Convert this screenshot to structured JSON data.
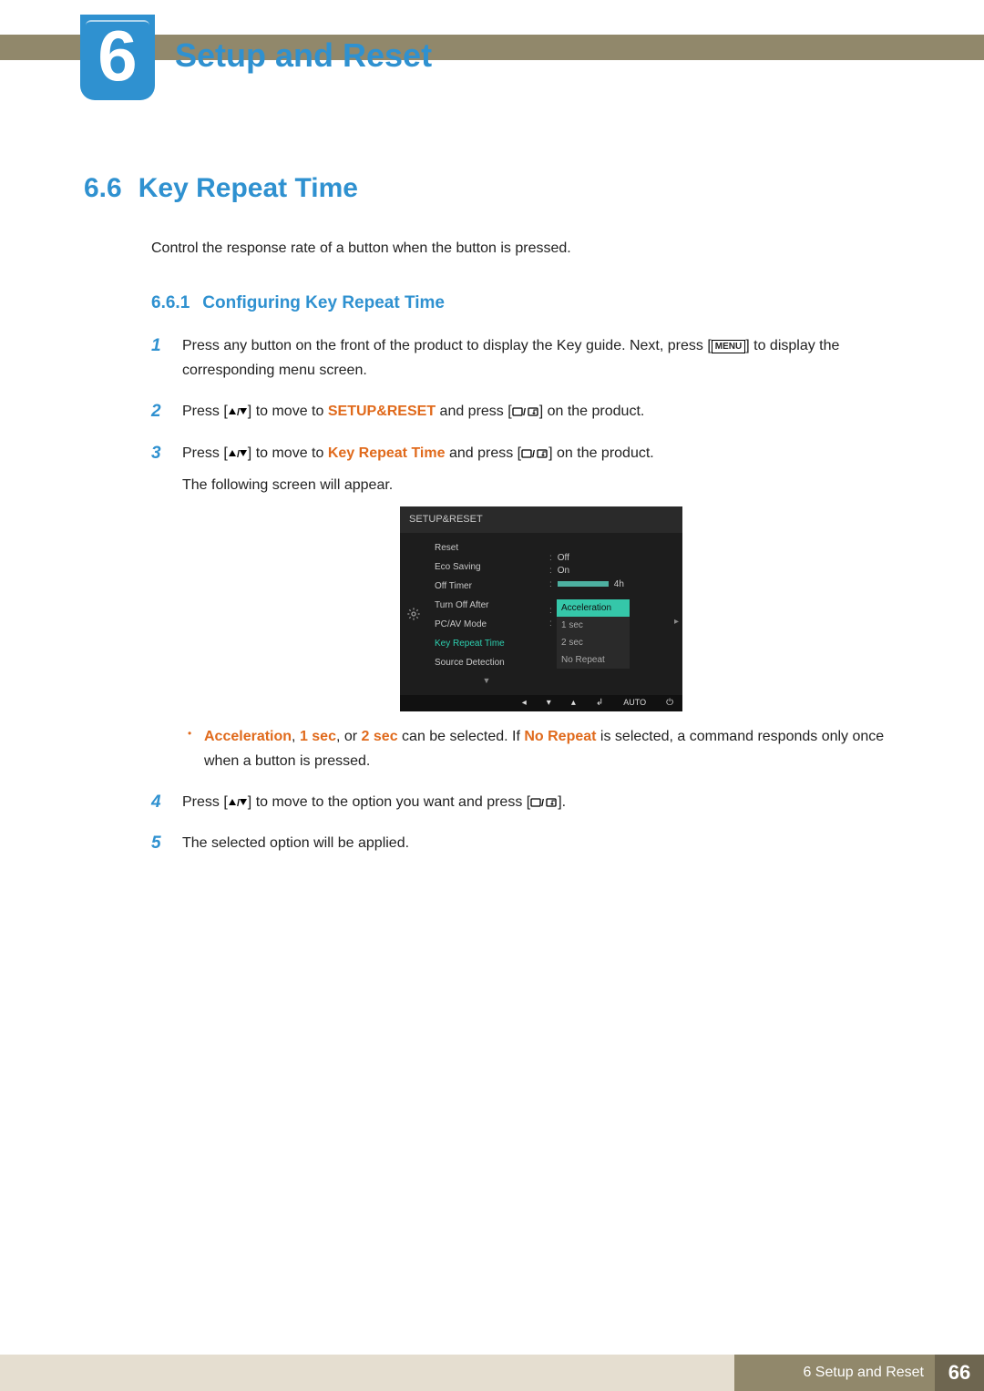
{
  "chapter": {
    "number": "6",
    "title": "Setup and Reset"
  },
  "section": {
    "number": "6.6",
    "title": "Key Repeat Time",
    "intro": "Control the response rate of a button when the button is pressed."
  },
  "subsection": {
    "number": "6.6.1",
    "title": "Configuring Key Repeat Time"
  },
  "steps": {
    "s1a": "Press any button on the front of the product to display the Key guide. Next, press [",
    "s1b": "] to display the corresponding menu screen.",
    "menu_label": "MENU",
    "s2a": "Press [",
    "s2b": "] to move to ",
    "s2_target": "SETUP&RESET",
    "s2c": " and press [",
    "s2d": "] on the product.",
    "s3a": "Press [",
    "s3b": "] to move to ",
    "s3_target": "Key Repeat Time",
    "s3c": " and press [",
    "s3d": "] on the product.",
    "s3e": "The following screen will appear.",
    "bullet_a": "Acceleration",
    "bullet_sep": ", ",
    "bullet_b": "1 sec",
    "bullet_or": ", or ",
    "bullet_c": "2 sec",
    "bullet_mid": " can be selected. If ",
    "bullet_d": "No Repeat",
    "bullet_end": " is selected, a command responds only once when a button is pressed.",
    "s4a": "Press [",
    "s4b": "] to move to the option you want and press [",
    "s4c": "].",
    "s5": "The selected option will be applied."
  },
  "osd": {
    "title": "SETUP&RESET",
    "items": [
      "Reset",
      "Eco Saving",
      "Off Timer",
      "Turn Off After",
      "PC/AV Mode",
      "Key Repeat Time",
      "Source Detection"
    ],
    "vals": {
      "eco": "Off",
      "timer": "On",
      "after": "4h"
    },
    "dropdown": [
      "Acceleration",
      "1 sec",
      "2 sec",
      "No Repeat"
    ],
    "footer_auto": "AUTO"
  },
  "footer": {
    "label": "6 Setup and Reset",
    "page": "66"
  }
}
